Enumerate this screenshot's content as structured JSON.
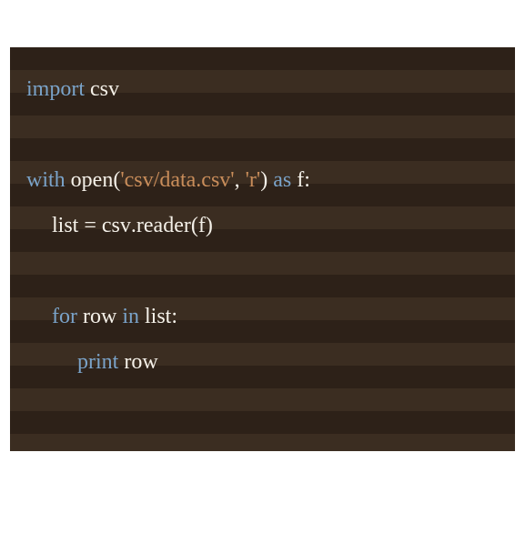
{
  "code": {
    "line1": {
      "kw": "import",
      "sp": " ",
      "mod": "csv"
    },
    "line3": {
      "kw1": "with",
      "sp1": " ",
      "fn": "open",
      "lp": "(",
      "str1": "'csv/data.csv'",
      "comma": ", ",
      "str2": "'r'",
      "rp": ")",
      "sp2": " ",
      "kw2": "as",
      "sp3": " ",
      "var": "f",
      "colon": ":"
    },
    "line4": {
      "lhs": "list",
      "eq": " = ",
      "mod": "csv",
      "dot": ".",
      "fn": "reader",
      "lp": "(",
      "arg": "f",
      "rp": ")"
    },
    "line6": {
      "kw1": "for",
      "sp1": " ",
      "var1": "row",
      "sp2": " ",
      "kw2": "in",
      "sp3": " ",
      "var2": "list",
      "colon": ":"
    },
    "line7": {
      "kw": "print",
      "sp": " ",
      "var": "row"
    }
  }
}
